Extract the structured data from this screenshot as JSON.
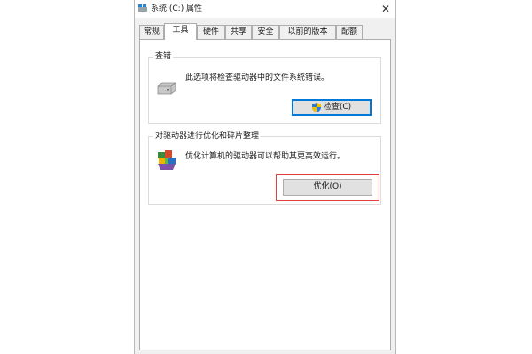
{
  "window": {
    "title": "系统 (C:) 属性",
    "close_glyph": "✕"
  },
  "tabs": [
    {
      "label": "常规",
      "active": false
    },
    {
      "label": "工具",
      "active": true
    },
    {
      "label": "硬件",
      "active": false
    },
    {
      "label": "共享",
      "active": false
    },
    {
      "label": "安全",
      "active": false
    },
    {
      "label": "以前的版本",
      "active": false
    },
    {
      "label": "配额",
      "active": false
    }
  ],
  "error_check": {
    "title": "查错",
    "description": "此选项将检查驱动器中的文件系统错误。",
    "button_label": "检查(C)",
    "icon": "drive-icon"
  },
  "optimize": {
    "title": "对驱动器进行优化和碎片整理",
    "description": "优化计算机的驱动器可以帮助其更高效运行。",
    "button_label": "优化(O)",
    "icon": "defrag-icon"
  },
  "colors": {
    "highlight": "#e04040",
    "default_button_border": "#0078d7"
  }
}
